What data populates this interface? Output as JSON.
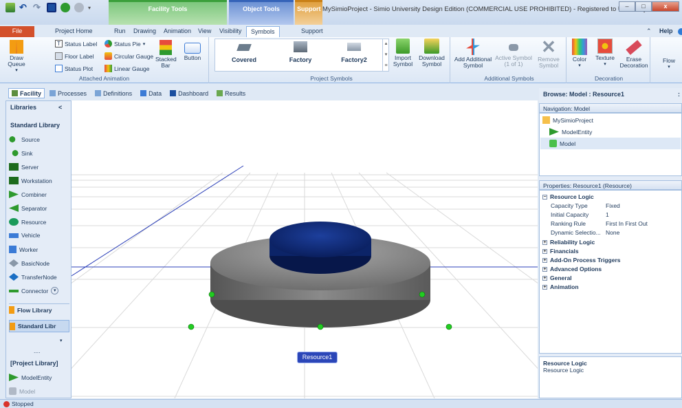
{
  "window": {
    "title": "MySimioProject - Simio University Design Edition (COMMERCIAL USE PROHIBITED) - Registered to University o...",
    "context_facility": "Facility Tools",
    "context_object": "Object Tools",
    "context_support": "Support",
    "min": "–",
    "max": "□",
    "close": "x"
  },
  "tabs": {
    "file": "File",
    "project_home": "Project Home",
    "run": "Run",
    "drawing": "Drawing",
    "animation": "Animation",
    "view": "View",
    "visibility": "Visibility",
    "symbols": "Symbols",
    "support": "Support",
    "help": "Help",
    "collapse": "⌃"
  },
  "ribbon": {
    "draw_queue": "Draw Queue",
    "status_label": "Status Label",
    "floor_label": "Floor Label",
    "status_plot": "Status Plot",
    "status_pie": "Status Pie",
    "circular_gauge": "Circular Gauge",
    "linear_gauge": "Linear Gauge",
    "stacked_bar": "Stacked Bar",
    "button": "Button",
    "group_attached": "Attached Animation",
    "sym_covered": "Covered",
    "sym_factory": "Factory",
    "sym_factory2": "Factory2",
    "import_symbol": "Import Symbol",
    "download_symbol": "Download Symbol",
    "group_project_symbols": "Project Symbols",
    "add_additional_symbol": "Add Additional Symbol",
    "active_symbol": "Active Symbol (1 of 1)",
    "remove_symbol": "Remove Symbol",
    "group_additional": "Additional Symbols",
    "color": "Color",
    "texture": "Texture",
    "erase_decoration": "Erase Decoration",
    "group_decoration": "Decoration",
    "flow": "Flow"
  },
  "view_tabs": [
    "Facility",
    "Processes",
    "Definitions",
    "Data",
    "Dashboard",
    "Results"
  ],
  "library": {
    "title": "Libraries",
    "collapse": "<",
    "standard_title": "Standard Library",
    "items": [
      "Source",
      "Sink",
      "Server",
      "Workstation",
      "Combiner",
      "Separator",
      "Resource",
      "Vehicle",
      "Worker",
      "BasicNode",
      "TransferNode",
      "Connector"
    ],
    "flow_library": "Flow Library",
    "standard_libr": "Standard Libr",
    "more": "....",
    "project_library": "[Project Library]",
    "project_items": [
      "ModelEntity",
      "Model"
    ]
  },
  "canvas": {
    "object_label": "Resource1"
  },
  "browse": {
    "title": "Browse: Model : Resource1",
    "pin": ":",
    "nav_header": "Navigation: Model",
    "nav_items": [
      "MySimioProject",
      "ModelEntity",
      "Model"
    ],
    "props_header": "Properties: Resource1 (Resource)",
    "categories": {
      "resource_logic": "Resource Logic",
      "reliability": "Reliability Logic",
      "financials": "Financials",
      "addon": "Add-On Process Triggers",
      "advanced": "Advanced Options",
      "general": "General",
      "animation": "Animation"
    },
    "props": [
      {
        "name": "Capacity Type",
        "value": "Fixed"
      },
      {
        "name": "Initial Capacity",
        "value": "1"
      },
      {
        "name": "Ranking Rule",
        "value": "First In First Out"
      },
      {
        "name": "Dynamic Selectio...",
        "value": "None"
      }
    ],
    "desc_title": "Resource Logic",
    "desc_text": "Resource Logic"
  },
  "status": {
    "text": "Stopped"
  },
  "colors": {
    "file_tab": "#d3502b",
    "object_top": "#0e2a78",
    "object_body": "#7a7a7a",
    "node_green": "#22cc22",
    "label_bg": "#2b46b8"
  }
}
